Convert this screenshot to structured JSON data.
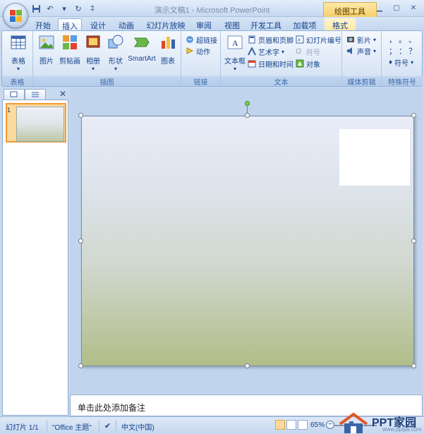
{
  "title_bar": {
    "title": "演示文稿1 - Microsoft PowerPoint",
    "tools_tab": "绘图工具"
  },
  "tabs": [
    {
      "label": "开始"
    },
    {
      "label": "插入"
    },
    {
      "label": "设计"
    },
    {
      "label": "动画"
    },
    {
      "label": "幻灯片放映"
    },
    {
      "label": "审阅"
    },
    {
      "label": "视图"
    },
    {
      "label": "开发工具"
    },
    {
      "label": "加载项"
    },
    {
      "label": "格式"
    }
  ],
  "active_tab": "插入",
  "ribbon": {
    "tables": {
      "label": "表格",
      "table_button": "表格"
    },
    "illustrations": {
      "label": "插图",
      "picture": "图片",
      "clipart": "剪贴画",
      "album": "相册",
      "shapes": "形状",
      "smartart": "SmartArt",
      "chart": "图表"
    },
    "links": {
      "label": "链接",
      "hyperlink": "超链接",
      "action": "动作"
    },
    "text": {
      "label": "文本",
      "textbox": "文本框",
      "header_footer": "页眉和页脚",
      "wordart": "艺术字",
      "datetime": "日期和时间",
      "slide_number": "幻灯片编号",
      "symbol": "符号",
      "object": "对象"
    },
    "media": {
      "label": "媒体剪辑",
      "movie": "影片",
      "sound": "声音"
    },
    "special_symbols": {
      "label": "特殊符号",
      "row1": "，  。  、",
      "row2": "；  ：  ？",
      "symbol": "符号"
    }
  },
  "notes_placeholder": "单击此处添加备注",
  "status_bar": {
    "slide_info": "幻灯片 1/1",
    "theme": "\"Office 主题\"",
    "language": "中文(中国)",
    "zoom": "65%"
  },
  "watermark": {
    "text": "PPT家园",
    "url": "www.pptjia.com"
  }
}
